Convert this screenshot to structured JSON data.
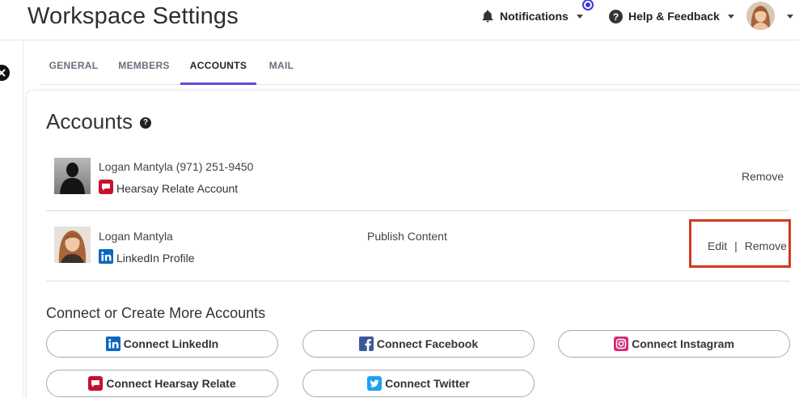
{
  "header": {
    "title": "Workspace Settings",
    "notifications_label": "Notifications",
    "help_label": "Help & Feedback"
  },
  "tabs": [
    {
      "label": "GENERAL",
      "active": false
    },
    {
      "label": "MEMBERS",
      "active": false
    },
    {
      "label": "ACCOUNTS",
      "active": true
    },
    {
      "label": "MAIL",
      "active": false
    }
  ],
  "accounts_section": {
    "title": "Accounts",
    "help_glyph": "?",
    "rows": [
      {
        "name": "Logan Mantyla (971) 251-9450",
        "type_label": "Hearsay Relate Account",
        "type_icon": "hearsay-relate-icon",
        "permission": "",
        "actions": [
          "Remove"
        ]
      },
      {
        "name": "Logan Mantyla",
        "type_label": "LinkedIn Profile",
        "type_icon": "linkedin-icon",
        "permission": "Publish Content",
        "actions": [
          "Edit",
          "Remove"
        ],
        "action_separator": "|"
      }
    ]
  },
  "connect_section": {
    "title": "Connect or Create More Accounts",
    "buttons": [
      {
        "label": "Connect LinkedIn",
        "icon": "linkedin-icon"
      },
      {
        "label": "Connect Facebook",
        "icon": "facebook-icon"
      },
      {
        "label": "Connect Instagram",
        "icon": "instagram-icon"
      },
      {
        "label": "Connect Hearsay Relate",
        "icon": "hearsay-relate-icon"
      },
      {
        "label": "Connect Twitter",
        "icon": "twitter-icon"
      }
    ]
  },
  "colors": {
    "accent": "#5b4fd6",
    "highlight_box": "#d23a1e",
    "linkedin": "#0a66c2",
    "facebook": "#3b5998",
    "instagram": "#d62976",
    "hearsay": "#c8102e",
    "twitter": "#1da1f2"
  }
}
